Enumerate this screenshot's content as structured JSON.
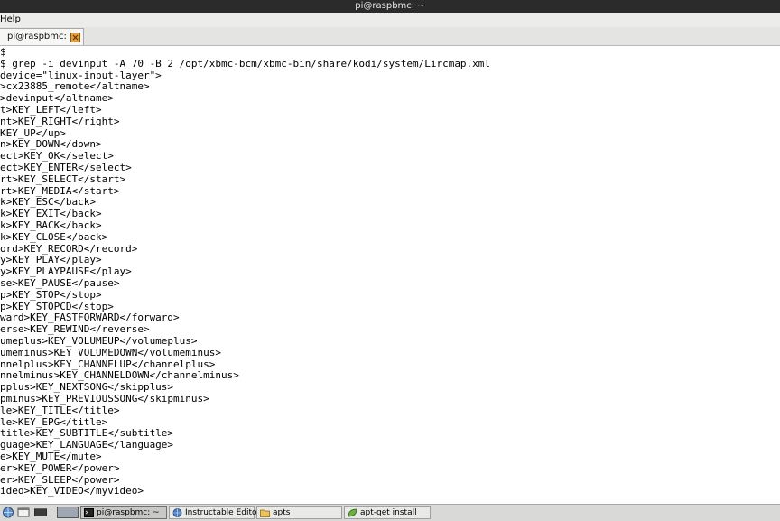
{
  "window": {
    "title": "pi@raspbmc: ~"
  },
  "menu": {
    "help": "Help"
  },
  "tab": {
    "label": "pi@raspbmc: ~"
  },
  "terminal": {
    "lines": [
      "$",
      "$ grep -i devinput -A 70 -B 2 /opt/xbmc-bcm/xbmc-bin/share/kodi/system/Lircmap.xml",
      "device=\"linux-input-layer\">",
      ">cx23885_remote</altname>",
      ">devinput</altname>",
      "t>KEY_LEFT</left>",
      "nt>KEY_RIGHT</right>",
      "KEY_UP</up>",
      "n>KEY_DOWN</down>",
      "ect>KEY_OK</select>",
      "ect>KEY_ENTER</select>",
      "rt>KEY_SELECT</start>",
      "rt>KEY_MEDIA</start>",
      "k>KEY_ESC</back>",
      "k>KEY_EXIT</back>",
      "k>KEY_BACK</back>",
      "k>KEY_CLOSE</back>",
      "ord>KEY_RECORD</record>",
      "y>KEY_PLAY</play>",
      "y>KEY_PLAYPAUSE</play>",
      "se>KEY_PAUSE</pause>",
      "p>KEY_STOP</stop>",
      "p>KEY_STOPCD</stop>",
      "ward>KEY_FASTFORWARD</forward>",
      "erse>KEY_REWIND</reverse>",
      "umeplus>KEY_VOLUMEUP</volumeplus>",
      "umeminus>KEY_VOLUMEDOWN</volumeminus>",
      "nnelplus>KEY_CHANNELUP</channelplus>",
      "nnelminus>KEY_CHANNELDOWN</channelminus>",
      "pplus>KEY_NEXTSONG</skipplus>",
      "pminus>KEY_PREVIOUSSONG</skipminus>",
      "le>KEY_TITLE</title>",
      "le>KEY_EPG</title>",
      "title>KEY_SUBTITLE</subtitle>",
      "guage>KEY_LANGUAGE</language>",
      "e>KEY_MUTE</mute>",
      "er>KEY_POWER</power>",
      "er>KEY_SLEEP</power>",
      "ideo>KEY_VIDEO</myvideo>"
    ]
  },
  "taskbar": {
    "buttons": [
      {
        "label": "pi@raspbmc: ~",
        "icon": "terminal-icon",
        "active": true
      },
      {
        "label": "Instructable Editor",
        "icon": "browser-globe-icon",
        "active": false
      },
      {
        "label": "apts",
        "icon": "folder-icon",
        "active": false
      },
      {
        "label": "apt-get install",
        "icon": "leaf-app-icon",
        "active": false
      }
    ]
  },
  "colors": {
    "titlebar": "#2b2b2b",
    "terminal_bg": "#ffffff",
    "terminal_fg": "#000000",
    "taskbar": "#d9d9d7"
  }
}
